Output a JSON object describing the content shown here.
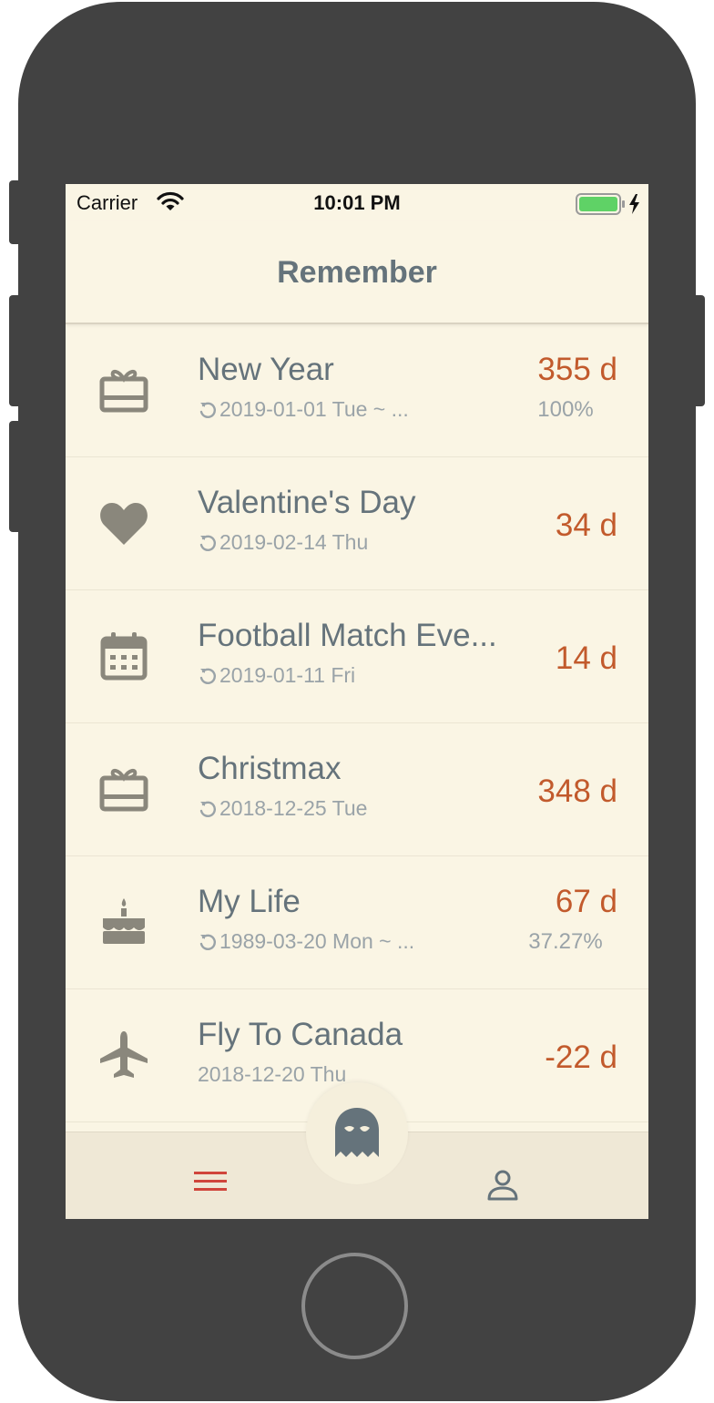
{
  "status_bar": {
    "carrier": "Carrier",
    "time": "10:01 PM",
    "battery_color": "#5fd266"
  },
  "header": {
    "title": "Remember"
  },
  "colors": {
    "background": "#faf5e4",
    "title": "#65737b",
    "days": "#c25a2c",
    "icon": "#8a877c",
    "tab_active": "#d0453b",
    "tab_inactive": "#65737b"
  },
  "events": [
    {
      "icon": "gift-card-icon",
      "name": "New Year",
      "date": "2019-01-01 Tue ~ ...",
      "repeat": true,
      "days": "355 d",
      "progress": "100%"
    },
    {
      "icon": "heart-icon",
      "name": "Valentine's Day",
      "date": "2019-02-14 Thu",
      "repeat": true,
      "days": "34 d",
      "progress": ""
    },
    {
      "icon": "calendar-icon",
      "name": "Football Match Eve...",
      "date": "2019-01-11 Fri",
      "repeat": true,
      "days": "14 d",
      "progress": ""
    },
    {
      "icon": "gift-card-icon",
      "name": "Christmax",
      "date": "2018-12-25 Tue",
      "repeat": true,
      "days": "348 d",
      "progress": ""
    },
    {
      "icon": "birthday-cake-icon",
      "name": "My Life",
      "date": "1989-03-20 Mon ~ ...",
      "repeat": true,
      "days": "67 d",
      "progress": "37.27%"
    },
    {
      "icon": "airplane-icon",
      "name": "Fly To Canada",
      "date": "2018-12-20 Thu",
      "repeat": false,
      "days": "-22 d",
      "progress": ""
    }
  ],
  "tab_bar": {
    "tabs": [
      {
        "icon": "menu-list-icon",
        "active": true
      },
      {
        "icon": "ghost-icon",
        "active": false
      },
      {
        "icon": "profile-icon",
        "active": false
      }
    ]
  }
}
